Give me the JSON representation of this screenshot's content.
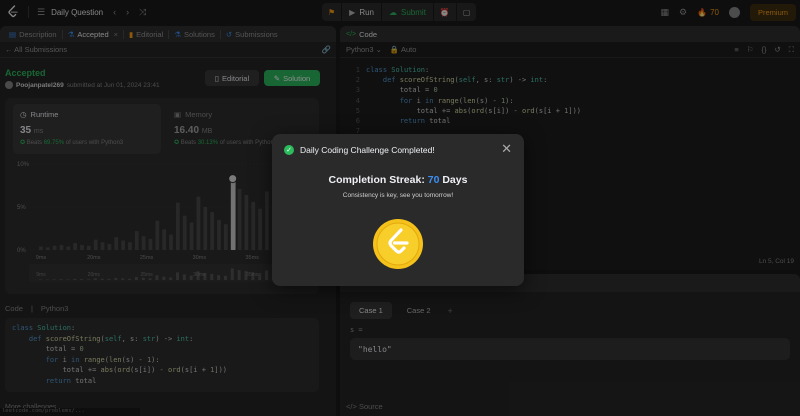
{
  "nav": {
    "title": "Daily Question",
    "run_label": "Run",
    "submit_label": "Submit",
    "streak_count": "70",
    "premium_label": "Premium"
  },
  "left": {
    "tabs": [
      {
        "label": "Description"
      },
      {
        "label": "Accepted"
      },
      {
        "label": "Editorial"
      },
      {
        "label": "Solutions"
      },
      {
        "label": "Submissions"
      }
    ],
    "all_submissions": "All Submissions",
    "status": "Accepted",
    "username": "Poojanpatel269",
    "submitted_text": "submitted at Jun 01, 2024 23:41",
    "editorial_button": "Editorial",
    "solution_button": "Solution",
    "runtime": {
      "label": "Runtime",
      "value": "35",
      "unit": "ms",
      "beats_prefix": "Beats",
      "beats_pct": "69.75%",
      "beats_suffix": "of users with Python3"
    },
    "memory": {
      "label": "Memory",
      "value": "16.40",
      "unit": "MB",
      "beats_prefix": "Beats",
      "beats_pct": "30.13%",
      "beats_suffix": "of users with Python3"
    },
    "code_label": "Code",
    "code_lang": "Python3",
    "code_lines": [
      "class Solution:",
      "    def scoreOfString(self, s: str) -> int:",
      "        total = 0",
      "        for i in range(len(s) - 1):",
      "            total += abs(ord(s[i]) - ord(s[i + 1]))",
      "        return total"
    ],
    "more_challenges": "More challenges",
    "status_url": "leetcode.com/problems/..."
  },
  "chart_data": {
    "type": "bar",
    "ytick_labels": [
      "10%",
      "5%",
      "0%"
    ],
    "xtick_labels": [
      "9ms",
      "20ms",
      "25ms",
      "30ms",
      "35ms",
      "40ms"
    ],
    "xtick_labels_lower": [
      "9ms",
      "20ms",
      "25ms",
      "30ms",
      "35ms",
      "40ms"
    ],
    "ylim": [
      0,
      10
    ],
    "values": [
      0.4,
      0.3,
      0.5,
      0.6,
      0.4,
      0.8,
      0.6,
      0.5,
      1.2,
      0.9,
      0.7,
      1.5,
      1.1,
      0.9,
      2.2,
      1.6,
      1.3,
      3.4,
      2.4,
      1.8,
      5.5,
      4.0,
      3.2,
      6.2,
      5.0,
      4.4,
      3.5,
      3.0,
      8.3,
      7.1,
      6.4,
      5.6,
      4.8,
      6.8,
      5.2,
      4.1,
      3.0,
      8.0,
      2.6,
      2.0
    ],
    "highlight_index": 28
  },
  "editor": {
    "tab_label": "Code",
    "lang": "Python3",
    "mode": "Auto",
    "cursor_pos": "Ln 5, Col 19",
    "line_numbers": [
      "1",
      "2",
      "3",
      "4",
      "5",
      "6",
      "7",
      "8",
      "9"
    ],
    "lines": [
      "class Solution:",
      "    def scoreOfString(self, s: str) -> int:",
      "        total = 0",
      "        for i in range(len(s) - 1):",
      "            total += abs(ord(s[i]) - ord(s[i + 1]))",
      "        return total",
      "",
      "",
      ""
    ]
  },
  "testcase": {
    "tabs": [
      "Testcase",
      "Test Result"
    ],
    "cases": [
      "Case 1",
      "Case 2"
    ],
    "var_label": "s =",
    "value": "\"hello\"",
    "source_label": "Source"
  },
  "modal": {
    "title": "Daily Coding Challenge Completed!",
    "streak_prefix": "Completion Streak:",
    "streak_num": "70",
    "streak_suffix": "Days",
    "subtitle": "Consistency is key, see you tomorrow!",
    "close_icon": "close-icon",
    "badge_color": "#f5c21b"
  }
}
